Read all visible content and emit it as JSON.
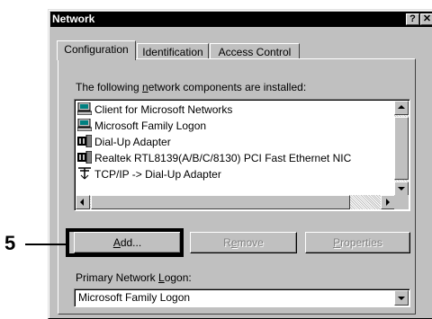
{
  "window": {
    "title": "Network",
    "help_label": "?",
    "close_label": "✕"
  },
  "tabs": [
    {
      "label": "Configuration",
      "active": true
    },
    {
      "label": "Identification",
      "active": false
    },
    {
      "label": "Access Control",
      "active": false
    }
  ],
  "components": {
    "label_pre": "The following ",
    "label_ul": "n",
    "label_post": "etwork components are installed:",
    "items": [
      {
        "label": "Client for Microsoft Networks",
        "icon": "client-icon"
      },
      {
        "label": "Microsoft Family Logon",
        "icon": "client-icon"
      },
      {
        "label": "Dial-Up Adapter",
        "icon": "adapter-icon"
      },
      {
        "label": "Realtek RTL8139(A/B/C/8130) PCI Fast Ethernet NIC",
        "icon": "adapter-icon"
      },
      {
        "label": "TCP/IP -> Dial-Up Adapter",
        "icon": "protocol-icon"
      }
    ]
  },
  "buttons": {
    "add_ul": "A",
    "add_rest": "dd...",
    "remove_pre": "R",
    "remove_ul": "e",
    "remove_post": "move",
    "properties_ul": "P",
    "properties_rest": "roperties"
  },
  "logon": {
    "label_pre": "Primary Network ",
    "label_ul": "L",
    "label_post": "ogon:",
    "value": "Microsoft Family Logon"
  },
  "callout": {
    "number": "5"
  }
}
